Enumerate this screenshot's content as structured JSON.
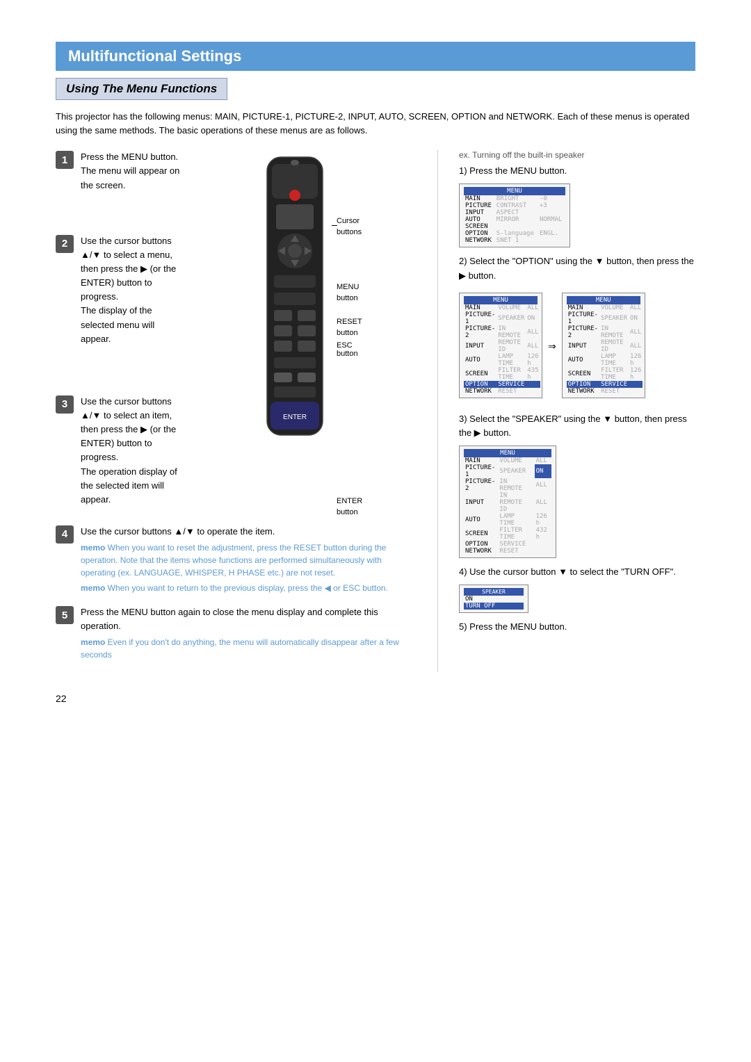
{
  "page": {
    "section_title": "Multifunctional Settings",
    "subsection_title": "Using The Menu Functions",
    "intro": "This projector has the following menus: MAIN, PICTURE-1, PICTURE-2, INPUT, AUTO, SCREEN, OPTION and NETWORK. Each of these menus is operated using the same methods. The basic operations of these menus are as follows.",
    "steps": [
      {
        "num": "1",
        "text": "Press the MENU button.\nThe menu will appear on the screen."
      },
      {
        "num": "2",
        "text": "Use the cursor buttons\n▲/▼ to select a menu, then press the ▶ (or the ENTER) button to progress.\nThe display of the selected menu will appear."
      },
      {
        "num": "3",
        "text": "Use the cursor buttons\n▲/▼ to select an item, then press the ▶ (or the ENTER) button to progress.\nThe operation display of the selected item will appear."
      },
      {
        "num": "4",
        "text": "Use the cursor buttons ▲/▼ to operate the item.",
        "memos": [
          "memo When you want to reset the adjustment, press the RESET button during the operation. Note that the items whose functions are performed simultaneously with operating (ex. LANGUAGE, WHISPER, H PHASE etc.) are not reset.",
          "memo When you want to return to the previous display, press the ◀ or ESC button."
        ]
      },
      {
        "num": "5",
        "text": "Press the MENU button again to close the menu display and complete this operation.",
        "memos": [
          "memo Even if you don't do anything, the menu will automatically disappear after a few seconds"
        ]
      }
    ],
    "remote_labels": {
      "cursor_buttons": "Cursor\nbuttons",
      "menu_button": "MENU\nbutton",
      "reset_button": "RESET\nbutton",
      "esc_button": "ESC button",
      "enter_button": "ENTER\nbutton"
    },
    "right_col": {
      "example_title": "ex. Turning off the built-in speaker",
      "steps": [
        {
          "num": "1)",
          "text": "Press the MENU button."
        },
        {
          "num": "2)",
          "text": "Select the \"OPTION\" using the ▼ button, then press the ▶ button."
        },
        {
          "num": "3)",
          "text": "Select the \"SPEAKER\" using the ▼ button, then press the ▶ button."
        },
        {
          "num": "4)",
          "text": "Use the cursor button ▼ to select the \"TURN OFF\"."
        },
        {
          "num": "5)",
          "text": "Press the MENU button."
        }
      ]
    },
    "page_number": "22"
  }
}
